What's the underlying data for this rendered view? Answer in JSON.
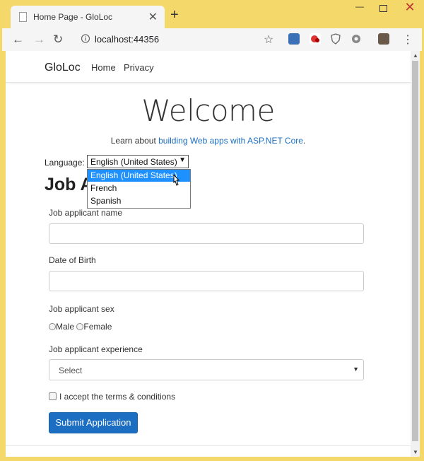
{
  "browser": {
    "tab_title": "Home Page - GloLoc",
    "tab_close": "✕",
    "new_tab": "+",
    "url": "localhost:44356",
    "back": "←",
    "forward": "→",
    "reload": "↻",
    "star": "☆",
    "menu": "⋮",
    "min": "—",
    "close": "✕"
  },
  "navbar": {
    "brand": "GloLoc",
    "links": [
      "Home",
      "Privacy"
    ]
  },
  "hero": {
    "title": "Welcome",
    "learn_prefix": "Learn about ",
    "learn_link": "building Web apps with ASP.NET Core",
    "learn_suffix": "."
  },
  "language": {
    "label": "Language:",
    "selected": "English (United States)",
    "arrow": "▼",
    "options": [
      "English (United States)",
      "French",
      "Spanish"
    ]
  },
  "form": {
    "heading": "Job A",
    "name_label": "Job applicant name",
    "dob_label": "Date of Birth",
    "sex_label": "Job applicant sex",
    "sex_options": [
      "Male",
      "Female"
    ],
    "experience_label": "Job applicant experience",
    "experience_value": "Select",
    "experience_arrow": "▼",
    "terms_label": "I accept the terms & conditions",
    "submit_label": "Submit Application"
  },
  "scroll": {
    "up": "▲",
    "down": "▼"
  },
  "colors": {
    "accent": "#1b6ec2",
    "window_frame": "#f4d96a",
    "dropdown_highlight": "#1e90ff"
  }
}
